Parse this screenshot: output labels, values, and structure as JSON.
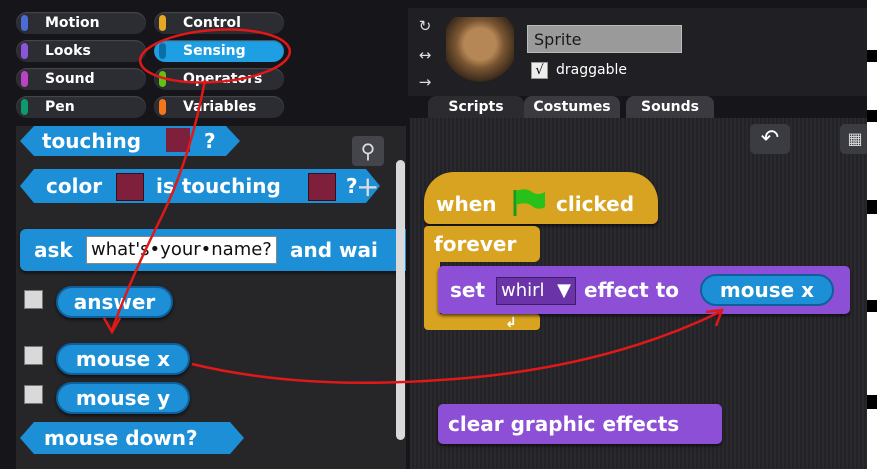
{
  "categories": [
    {
      "label": "Motion",
      "color": "#4a6cd4",
      "selected": false
    },
    {
      "label": "Looks",
      "color": "#8a55d7",
      "selected": false
    },
    {
      "label": "Sound",
      "color": "#bb42c3",
      "selected": false
    },
    {
      "label": "Pen",
      "color": "#0e9a6c",
      "selected": false
    },
    {
      "label": "Control",
      "color": "#e6a822",
      "selected": false
    },
    {
      "label": "Sensing",
      "color": "#0494dc",
      "selected": true
    },
    {
      "label": "Operators",
      "color": "#62c213",
      "selected": false
    },
    {
      "label": "Variables",
      "color": "#f3761d",
      "selected": false
    }
  ],
  "palette": {
    "touching": {
      "label": "touching",
      "suffix": "?"
    },
    "color_touching": {
      "prefix": "color",
      "middle": "is touching",
      "suffix": "?"
    },
    "ask": {
      "prefix": "ask",
      "default_text": "what's•your•name?",
      "suffix": "and wai"
    },
    "answer": "answer",
    "mouse_x": "mouse x",
    "mouse_y": "mouse y",
    "mouse_down": "mouse down?",
    "zoom_icon": "magnifier-icon",
    "add_icon": "plus-icon"
  },
  "sprite": {
    "name": "Sprite",
    "draggable_label": "draggable",
    "draggable_checked": true,
    "check_mark": "√"
  },
  "tabs": [
    {
      "label": "Scripts",
      "active": true
    },
    {
      "label": "Costumes",
      "active": false
    },
    {
      "label": "Sounds",
      "active": false
    }
  ],
  "script": {
    "hat": {
      "prefix": "when",
      "suffix": "clicked"
    },
    "forever": "forever",
    "set_effect": {
      "prefix": "set",
      "effect": "whirl",
      "middle": "effect to",
      "value": "mouse x"
    },
    "clear": "clear graphic effects"
  },
  "toolbar": {
    "undo_icon": "↶"
  }
}
